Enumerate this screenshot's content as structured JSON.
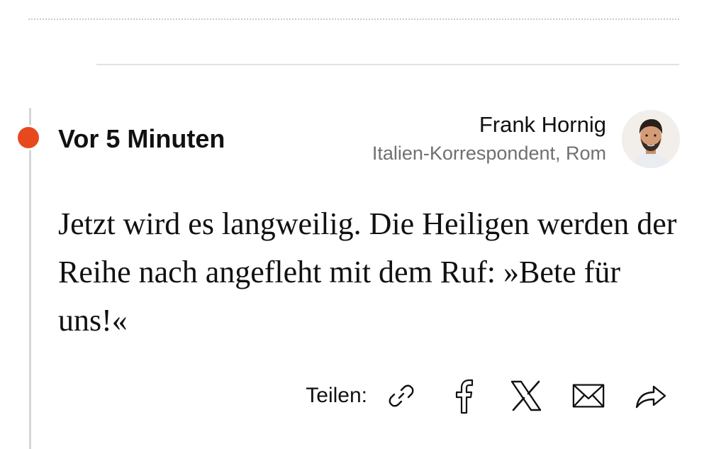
{
  "entry": {
    "timestamp": "Vor 5 Minuten",
    "author": {
      "name": "Frank Hornig",
      "role": "Italien-Korrespondent, Rom",
      "avatar_icon": "author-portrait"
    },
    "text": "Jetzt wird es langweilig. Die Heiligen werden der Reihe nach angefleht mit dem Ruf: »Bete für uns!«",
    "live_indicator_color": "#e8481e"
  },
  "share": {
    "label": "Teilen:",
    "buttons": [
      {
        "icon": "link-icon"
      },
      {
        "icon": "facebook-icon"
      },
      {
        "icon": "x-icon"
      },
      {
        "icon": "mail-icon"
      },
      {
        "icon": "share-arrow-icon"
      }
    ]
  }
}
